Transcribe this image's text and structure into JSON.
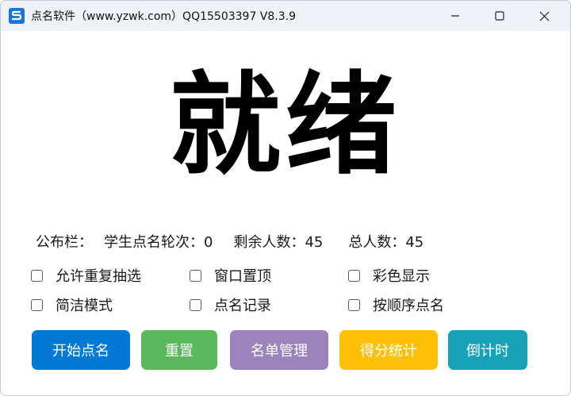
{
  "window": {
    "title": "点名软件（www.yzwk.com）QQ15503397 V8.3.9",
    "controls": {
      "minimize": "minimize",
      "maximize": "maximize",
      "close": "close"
    }
  },
  "main": {
    "status_text": "就绪"
  },
  "bulletin": {
    "label": "公布栏：",
    "round_label": "学生点名轮次：",
    "round_value": "0",
    "remaining_label": "剩余人数：",
    "remaining_value": "45",
    "total_label": "总人数：",
    "total_value": "45"
  },
  "options": [
    {
      "label": "允许重复抽选",
      "checked": false
    },
    {
      "label": "窗口置顶",
      "checked": false
    },
    {
      "label": "彩色显示",
      "checked": false
    },
    {
      "label": "简洁模式",
      "checked": false
    },
    {
      "label": "点名记录",
      "checked": false
    },
    {
      "label": "按顺序点名",
      "checked": false
    }
  ],
  "buttons": [
    {
      "label": "开始点名",
      "color": "#0078d4"
    },
    {
      "label": "重置",
      "color": "#5cb85c"
    },
    {
      "label": "名单管理",
      "color": "#9b84bb"
    },
    {
      "label": "得分统计",
      "color": "#ffc107"
    },
    {
      "label": "倒计时",
      "color": "#17a2b8"
    }
  ]
}
